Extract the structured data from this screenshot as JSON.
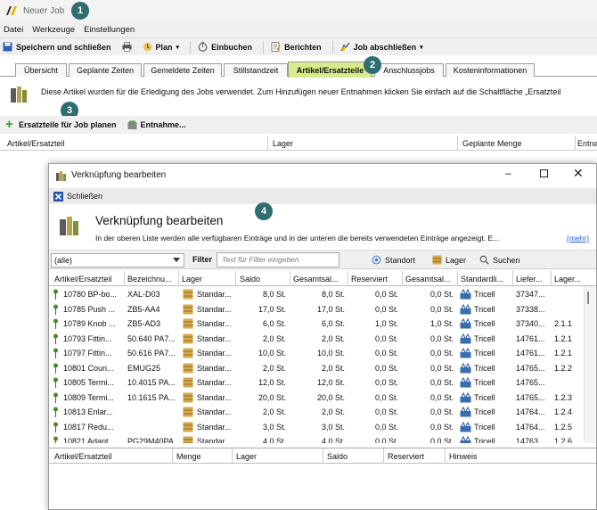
{
  "window": {
    "title": "Neuer Job"
  },
  "callouts": [
    "1",
    "2",
    "3",
    "4"
  ],
  "menu": [
    "Datei",
    "Werkzeuge",
    "Einstellungen"
  ],
  "toolbar": {
    "save_close": "Speichern und schließen",
    "plan": "Plan",
    "book": "Einbuchen",
    "reports": "Berichten",
    "finish_job": "Job abschließen"
  },
  "tabs": [
    "Übersicht",
    "Geplante Zeiten",
    "Gemeldete Zeiten",
    "Stillstandzeit",
    "Artikel/Ersatzteile",
    "Anschlussjobs",
    "Kosteninformationen"
  ],
  "info_text": "Diese Artikel wurden für die Erledigung des Jobs verwendet. Zum Hinzufügen neuer Entnahmen klicken Sie einfach auf die Schaltfläche „Ersatzteil",
  "actions": {
    "plan_parts": "Ersatzteile für Job planen",
    "withdrawal": "Entnahme..."
  },
  "main_columns": [
    "Artikel/Ersatzteil",
    "Lager",
    "Geplante Menge",
    "Entna"
  ],
  "dialog": {
    "title": "Verknüpfung bearbeiten",
    "close": "Schließen",
    "heading": "Verknüpfung bearbeiten",
    "subtext": "In der oberen Liste werden alle verfügbaren Einträge und in der unteren die bereits verwendeten Einträge angezeigt. E...",
    "more": "(mehr)",
    "combo_value": "(alle)",
    "filter_label": "Filter",
    "filter_placeholder": "Text für Filter eingeben",
    "btn_location": "Standort",
    "btn_stock": "Lager",
    "btn_search": "Suchen",
    "columns": [
      "Artikel/Ersatzteil",
      "Bezeichnu...",
      "Lager",
      "Saldo",
      "Gesamtsal...",
      "Reserviert",
      "Gesamtsal...",
      "Standardli...",
      "Liefer...",
      "Lager..."
    ],
    "rows": [
      [
        "10780 BP-bo...",
        "XAL-D03",
        "Standar...",
        "8,0 St.",
        "8,0 St.",
        "0,0 St.",
        "0,0 St.",
        "Tricell",
        "37347...",
        ""
      ],
      [
        "10785 Push ...",
        "ZB5-AA4",
        "Standar...",
        "17,0 St.",
        "17,0 St.",
        "0,0 St.",
        "0,0 St.",
        "Tricell",
        "37338...",
        ""
      ],
      [
        "10789 Knob ...",
        "ZB5-AD3",
        "Standar...",
        "6,0 St.",
        "6,0 St.",
        "1,0 St.",
        "1,0 St.",
        "Tricell",
        "37340...",
        "2.1.1"
      ],
      [
        "10793 Fittin...",
        "50.640 PA7...",
        "Standar...",
        "2,0 St.",
        "2,0 St.",
        "0,0 St.",
        "0,0 St.",
        "Tricell",
        "14761...",
        "1.2.1"
      ],
      [
        "10797 Fittin...",
        "50.616 PA7...",
        "Standar...",
        "10,0 St.",
        "10,0 St.",
        "0,0 St.",
        "0,0 St.",
        "Tricell",
        "14761...",
        "1.2.1"
      ],
      [
        "10801 Coun...",
        "EMUG25",
        "Standar...",
        "2,0 St.",
        "2,0 St.",
        "0,0 St.",
        "0,0 St.",
        "Tricell",
        "14765...",
        "1.2.2"
      ],
      [
        "10805 Termi...",
        "10.4015 PA...",
        "Standar...",
        "12,0 St.",
        "12,0 St.",
        "0,0 St.",
        "0,0 St.",
        "Tricell",
        "14765...",
        ""
      ],
      [
        "10809 Termi...",
        "10.1615 PA...",
        "Standar...",
        "20,0 St.",
        "20,0 St.",
        "0,0 St.",
        "0,0 St.",
        "Tricell",
        "14765...",
        "1.2.3"
      ],
      [
        "10813 Enlar...",
        "",
        "Standar...",
        "2,0 St.",
        "2,0 St.",
        "0,0 St.",
        "0,0 St.",
        "Tricell",
        "14764...",
        "1.2.4"
      ],
      [
        "10817 Redu...",
        "",
        "Standar...",
        "3,0 St.",
        "3,0 St.",
        "0,0 St.",
        "0,0 St.",
        "Tricell",
        "14764...",
        "1.2.5"
      ],
      [
        "10821 Adapt...",
        "PG29M40PA",
        "Standar...",
        "4,0 St.",
        "4,0 St.",
        "0,0 St.",
        "0,0 St.",
        "Tricell",
        "14763...",
        "1.2.6"
      ]
    ],
    "lower_columns": [
      "Artikel/Ersatzteil",
      "Menge",
      "Lager",
      "Saldo",
      "Reserviert",
      "Hinweis"
    ]
  }
}
